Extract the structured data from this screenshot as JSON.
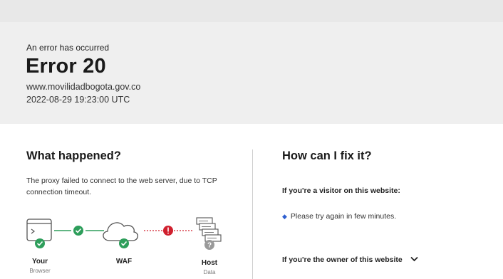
{
  "header": {
    "label": "An error has occurred",
    "title": "Error 20",
    "domain": "www.movilidadbogota.gov.co",
    "timestamp": "2022-08-29 19:23:00 UTC"
  },
  "what_happened": {
    "title": "What happened?",
    "description": "The proxy failed to connect to the web server, due to TCP connection timeout."
  },
  "diagram": {
    "nodes": [
      {
        "label": "Your",
        "sublabel": "Browser",
        "status": "ok",
        "icon": "browser-icon"
      },
      {
        "label": "WAF",
        "sublabel": "",
        "status": "ok",
        "icon": "cloud-icon"
      },
      {
        "label": "Host",
        "sublabel": "Data",
        "status": "unknown",
        "icon": "server-icon"
      }
    ],
    "links": [
      {
        "from": "Your",
        "to": "WAF",
        "status": "ok"
      },
      {
        "from": "WAF",
        "to": "Host",
        "status": "error"
      }
    ],
    "colors": {
      "ok": "#2e9e5b",
      "error": "#d0202e",
      "unknown": "#9a9a9a",
      "outline": "#555555"
    }
  },
  "fix": {
    "title": "How can I fix it?",
    "visitor_heading": "If you're a visitor on this website:",
    "visitor_items": [
      "Please try again in few minutes."
    ],
    "owner_heading": "If you're the owner of this website"
  }
}
